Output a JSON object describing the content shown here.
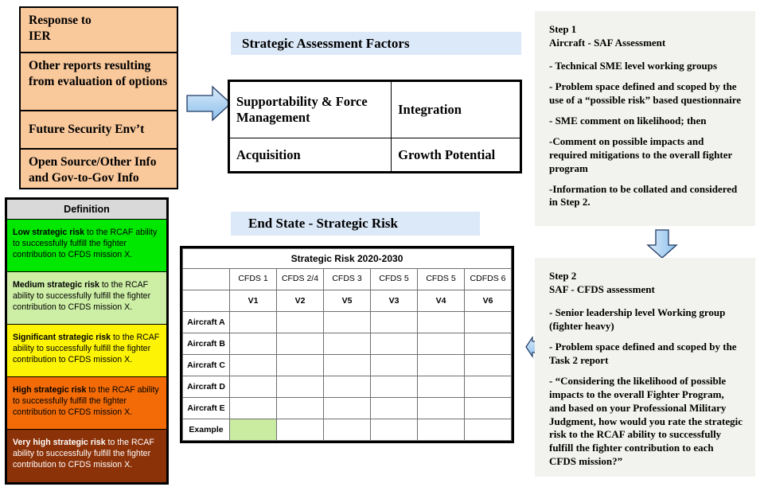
{
  "sources": {
    "items": [
      "Response to\nIER",
      "Other reports resulting from evaluation of options",
      "Future Security Env’t",
      "Open Source/Other Info  and Gov-to-Gov Info"
    ]
  },
  "legend": {
    "header": "Definition",
    "rows": [
      {
        "level": "Low strategic risk",
        "text": " to the RCAF ability to successfully fulfill the fighter contribution to CFDS mission X.",
        "color": "#00E800",
        "text_color": "#000000"
      },
      {
        "level": "Medium strategic risk",
        "text": " to the RCAF ability to successfully fulfill the fighter contribution to CFDS mission X.",
        "color": "#CDEEA5",
        "text_color": "#000000"
      },
      {
        "level": "Significant strategic risk",
        "text": " to the RCAF ability to successfully fulfill the fighter contribution to CFDS mission X.",
        "color": "#FCF404",
        "text_color": "#000000"
      },
      {
        "level": "High strategic risk",
        "text": " to the RCAF ability to successfully fulfill the fighter contribution to CFDS mission X.",
        "color": "#F26B07",
        "text_color": "#000000"
      },
      {
        "level": "Very high strategic risk",
        "text": " to the RCAF ability to successfully fulfill the fighter contribution to CFDS mission X.",
        "color": "#8C3208",
        "text_color": "#FFFFFF"
      }
    ]
  },
  "banners": {
    "saf": "Strategic Assessment Factors",
    "end_state": "End State - Strategic Risk"
  },
  "factors": {
    "cells": [
      [
        "Supportability & Force Management",
        "Integration"
      ],
      [
        "Acquisition",
        "Growth Potential"
      ]
    ]
  },
  "risk_table": {
    "title": "Strategic Risk 2020-2030",
    "corner_label": "",
    "mission_headers": [
      "CFDS 1",
      "CFDS 2/4",
      "CFDS 3",
      "CFDS 5",
      "CFDS 5",
      "CDFDS 6"
    ],
    "version_headers": [
      "V1",
      "V2",
      "V5",
      "V3",
      "V4",
      "V6"
    ],
    "rows": [
      {
        "label": "Aircraft A",
        "cells": [
          "",
          "",
          "",
          "",
          "",
          ""
        ],
        "highlight": -1
      },
      {
        "label": "Aircraft B",
        "cells": [
          "",
          "",
          "",
          "",
          "",
          ""
        ],
        "highlight": -1
      },
      {
        "label": "Aircraft C",
        "cells": [
          "",
          "",
          "",
          "",
          "",
          ""
        ],
        "highlight": -1
      },
      {
        "label": "Aircraft D",
        "cells": [
          "",
          "",
          "",
          "",
          "",
          ""
        ],
        "highlight": -1
      },
      {
        "label": "Aircraft E",
        "cells": [
          "",
          "",
          "",
          "",
          "",
          ""
        ],
        "highlight": -1
      },
      {
        "label": "Example",
        "cells": [
          "",
          "",
          "",
          "",
          "",
          ""
        ],
        "highlight": 0
      }
    ],
    "highlight_color": "#C9ECA0"
  },
  "step1": {
    "heading": "Step 1\nAircraft - SAF Assessment",
    "bullets": [
      "- Technical SME level working groups",
      "- Problem space defined and scoped by the use of a “possible risk” based questionnaire",
      "- SME comment on likelihood; then",
      "-Comment on possible impacts and required mitigations to the overall fighter program",
      "-Information to be collated and considered in Step 2."
    ]
  },
  "step2": {
    "heading": "Step 2\nSAF - CFDS assessment",
    "bullets": [
      "- Senior leadership level Working group (fighter heavy)",
      "- Problem space defined and scoped by the Task 2 report",
      "- “Considering the likelihood of possible impacts to the overall Fighter Program, and based on your Professional Military Judgment, how would you rate the strategic risk to the RCAF ability to successfully fulfill the fighter contribution to each CFDS mission?”"
    ]
  },
  "colors": {
    "source_fill": "#F9C89B",
    "banner_fill": "#DCE9F9",
    "panel_fill": "#F2F2EE",
    "arrow_fill": "#AFD3F2",
    "arrow_stroke": "#2F5496"
  }
}
